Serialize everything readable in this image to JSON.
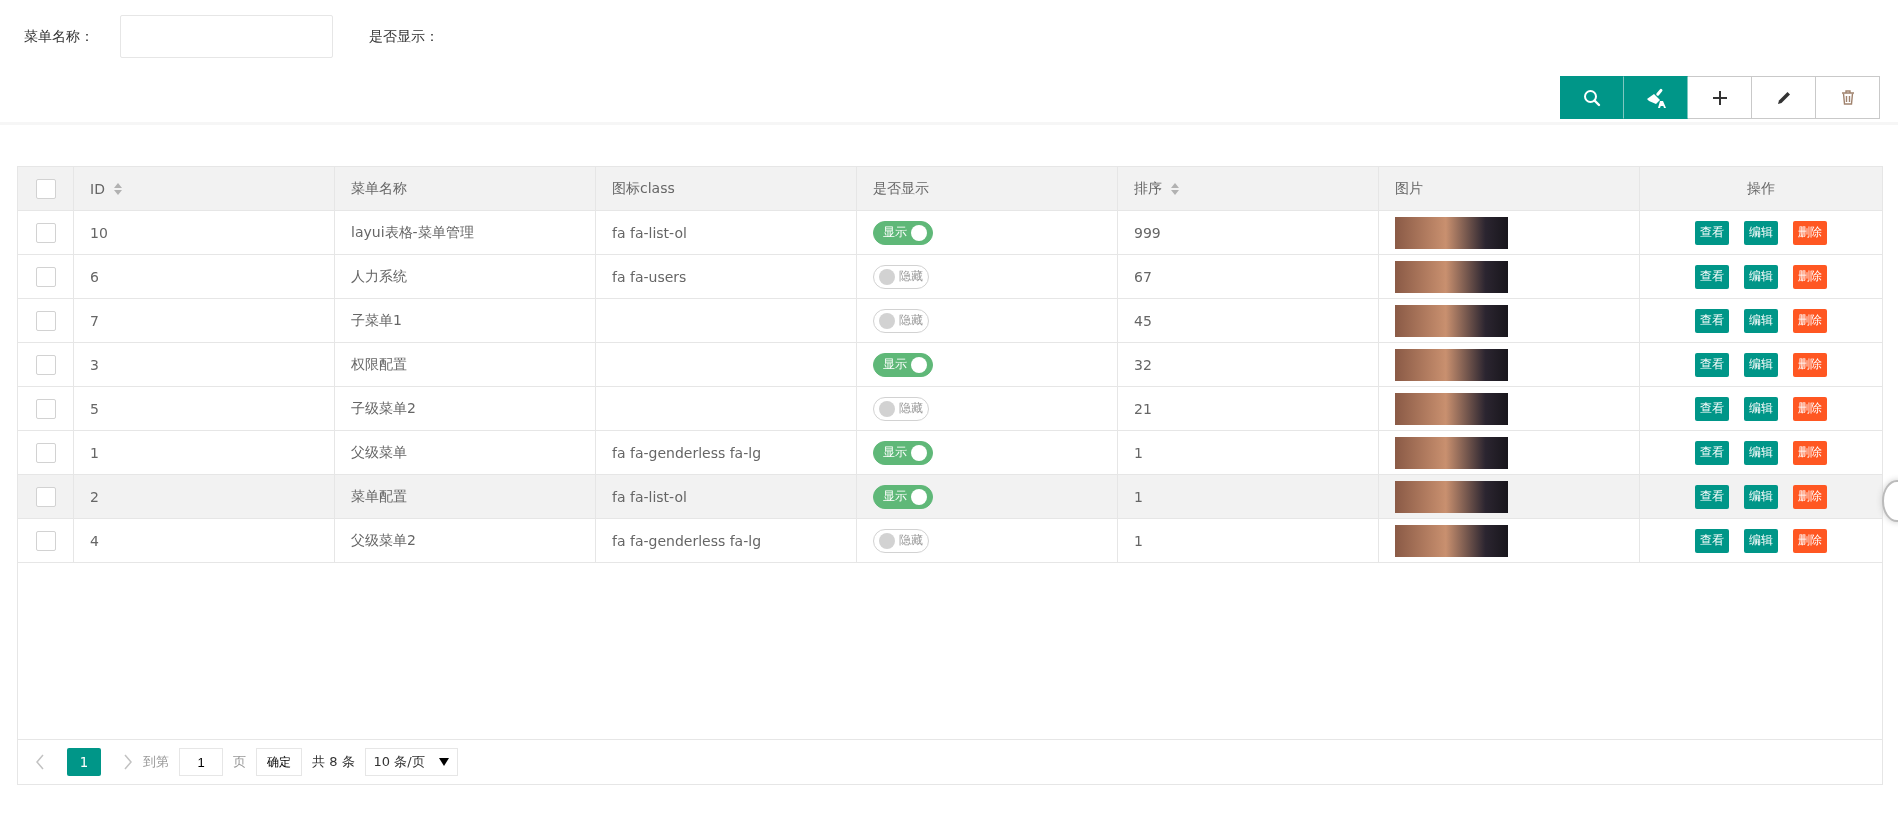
{
  "search_form": {
    "name_label": "菜单名称：",
    "show_label": "是否显示："
  },
  "toolbar": [
    {
      "kind": "search",
      "primary": true
    },
    {
      "kind": "clear",
      "primary": true
    },
    {
      "kind": "add",
      "primary": false
    },
    {
      "kind": "edit",
      "primary": false
    },
    {
      "kind": "delete",
      "primary": false
    }
  ],
  "table": {
    "select_all_checked": false,
    "columns": [
      {
        "label": "ID",
        "sortable": true
      },
      {
        "label": "菜单名称",
        "sortable": false
      },
      {
        "label": "图标class",
        "sortable": false
      },
      {
        "label": "是否显示",
        "sortable": false
      },
      {
        "label": "排序",
        "sortable": true
      },
      {
        "label": "图片",
        "sortable": false
      },
      {
        "label": "操作",
        "sortable": false
      }
    ],
    "rows": [
      {
        "checked": false,
        "hovered": false,
        "id": "10",
        "name": "layui表格-菜单管理",
        "icon_class": "fa fa-list-ol",
        "show": {
          "on": true,
          "label": "显示"
        },
        "sort": "999",
        "actions": [
          "查看",
          "编辑",
          "删除"
        ]
      },
      {
        "checked": false,
        "hovered": false,
        "id": "6",
        "name": "人力系统",
        "icon_class": "fa fa-users",
        "show": {
          "on": false,
          "label": "隐藏"
        },
        "sort": "67",
        "actions": [
          "查看",
          "编辑",
          "删除"
        ]
      },
      {
        "checked": false,
        "hovered": false,
        "id": "7",
        "name": "子菜单1",
        "show": {
          "on": false,
          "label": "隐藏"
        },
        "sort": "45",
        "actions": [
          "查看",
          "编辑",
          "删除"
        ]
      },
      {
        "checked": false,
        "hovered": false,
        "id": "3",
        "name": "权限配置",
        "show": {
          "on": true,
          "label": "显示"
        },
        "sort": "32",
        "actions": [
          "查看",
          "编辑",
          "删除"
        ]
      },
      {
        "checked": false,
        "hovered": false,
        "id": "5",
        "name": "子级菜单2",
        "show": {
          "on": false,
          "label": "隐藏"
        },
        "sort": "21",
        "actions": [
          "查看",
          "编辑",
          "删除"
        ]
      },
      {
        "checked": false,
        "hovered": false,
        "id": "1",
        "name": "父级菜单",
        "icon_class": "fa fa-genderless fa-lg",
        "show": {
          "on": true,
          "label": "显示"
        },
        "sort": "1",
        "actions": [
          "查看",
          "编辑",
          "删除"
        ]
      },
      {
        "checked": false,
        "hovered": true,
        "id": "2",
        "name": "菜单配置",
        "icon_class": "fa fa-list-ol",
        "show": {
          "on": true,
          "label": "显示"
        },
        "sort": "1",
        "actions": [
          "查看",
          "编辑",
          "删除"
        ]
      },
      {
        "checked": false,
        "hovered": false,
        "id": "4",
        "name": "父级菜单2",
        "icon_class": "fa fa-genderless fa-lg",
        "show": {
          "on": false,
          "label": "隐藏"
        },
        "sort": "1",
        "actions": [
          "查看",
          "编辑",
          "删除"
        ]
      }
    ]
  },
  "pagination": {
    "pages": [
      {
        "label": "1",
        "selected": true
      }
    ],
    "goto_label": "到第",
    "goto_value": "1",
    "page_unit": "页",
    "confirm": "确定",
    "total": "共 8 条",
    "page_size": "10 条/页"
  }
}
